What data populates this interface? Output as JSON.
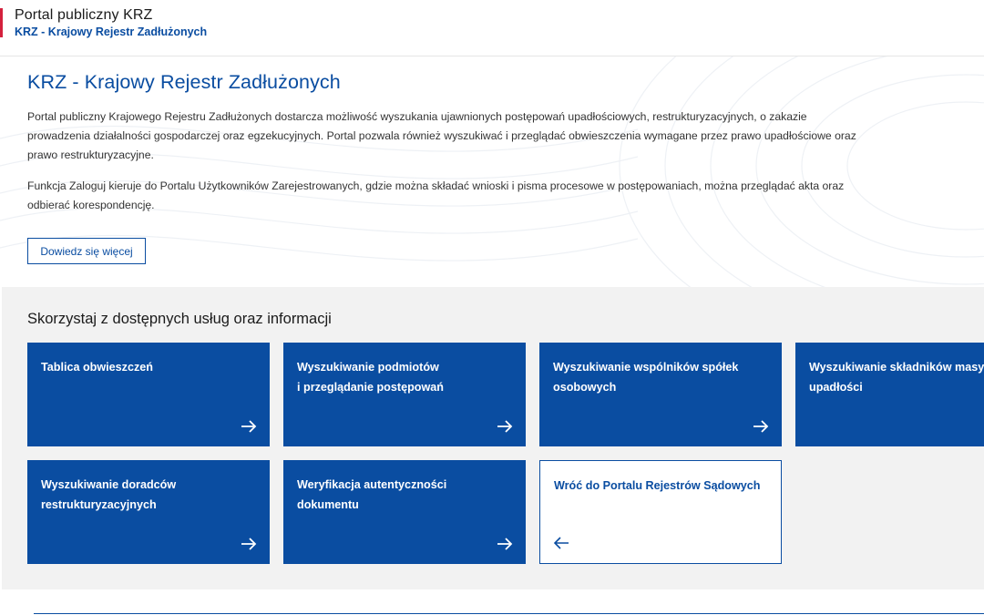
{
  "header": {
    "title": "Portal publiczny KRZ",
    "subtitle": "KRZ - Krajowy Rejestr Zadłużonych",
    "accent_color": "#d4213d"
  },
  "intro": {
    "heading": "KRZ - Krajowy Rejestr Zadłużonych",
    "paragraph1": "Portal publiczny Krajowego Rejestru Zadłużonych dostarcza możliwość wyszukania ujawnionych postępowań upadłościowych, restrukturyzacyjnych, o zakazie prowadzenia działalności gospodarczej oraz egzekucyjnych. Portal pozwala również wyszukiwać i przeglądać obwieszczenia wymagane przez prawo upadłościowe oraz prawo restrukturyzacyjne.",
    "paragraph2": "Funkcja Zaloguj kieruje do Portalu Użytkowników Zarejestrowanych, gdzie można składać wnioski i pisma procesowe w postępowaniach, można przeglądać akta oraz odbierać korespondencję.",
    "learn_more_label": "Dowiedz się więcej"
  },
  "services": {
    "heading": "Skorzystaj z dostępnych usług oraz informacji",
    "tiles": [
      {
        "label": "Tablica obwieszczeń",
        "icon": "arrow-right-icon"
      },
      {
        "label": "Wyszukiwanie podmiotów\ni przeglądanie postępowań",
        "icon": "arrow-right-icon"
      },
      {
        "label": "Wyszukiwanie wspólników spółek\nosobowych",
        "icon": "arrow-right-icon"
      },
      {
        "label": "Wyszukiwanie składników masy\nupadłości",
        "icon": "arrow-right-icon"
      },
      {
        "label": "Wyszukiwanie doradców\nrestrukturyzacyjnych",
        "icon": "arrow-right-icon"
      },
      {
        "label": "Weryfikacja autentyczności\ndokumentu",
        "icon": "arrow-right-icon"
      },
      {
        "label": "Wróć do Portalu Rejestrów Sądowych",
        "icon": "arrow-left-icon"
      }
    ]
  },
  "colors": {
    "primary": "#0a4da1",
    "section_bg": "#f2f2f2"
  }
}
